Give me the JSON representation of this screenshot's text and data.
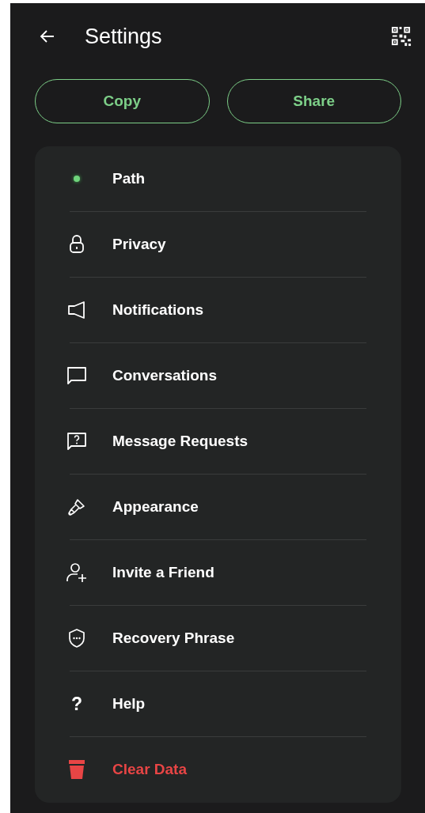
{
  "header": {
    "title": "Settings"
  },
  "actions": [
    {
      "label": "Copy"
    },
    {
      "label": "Share"
    }
  ],
  "items": [
    {
      "kind": "dot",
      "label": "Path",
      "danger": false
    },
    {
      "kind": "lock",
      "label": "Privacy",
      "danger": false
    },
    {
      "kind": "speaker",
      "label": "Notifications",
      "danger": false
    },
    {
      "kind": "chat",
      "label": "Conversations",
      "danger": false
    },
    {
      "kind": "request",
      "label": "Message Requests",
      "danger": false
    },
    {
      "kind": "brush",
      "label": "Appearance",
      "danger": false
    },
    {
      "kind": "invite",
      "label": "Invite a Friend",
      "danger": false
    },
    {
      "kind": "shield",
      "label": "Recovery Phrase",
      "danger": false
    },
    {
      "kind": "glyph",
      "glyph": "?",
      "label": "Help",
      "danger": false
    },
    {
      "kind": "trash",
      "label": "Clear Data",
      "danger": true
    }
  ]
}
